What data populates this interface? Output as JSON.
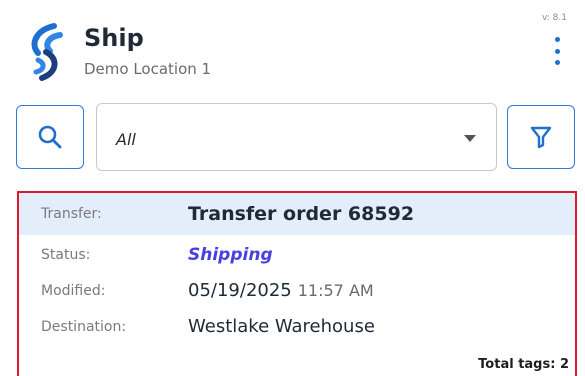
{
  "app": {
    "title": "Ship",
    "location": "Demo Location 1",
    "version": "v: 8.1",
    "brand_color": "#1f6fd1"
  },
  "filter": {
    "search_icon": "search-icon",
    "selected": "All",
    "filter_icon": "funnel-icon"
  },
  "card": {
    "transfer_label": "Transfer:",
    "transfer_value": "Transfer order 68592",
    "status_label": "Status:",
    "status_value": "Shipping",
    "status_color": "#4a3fe0",
    "modified_label": "Modified:",
    "modified_date": "05/19/2025",
    "modified_time": "11:57 AM",
    "destination_label": "Destination:",
    "destination_value": "Westlake Warehouse",
    "total_tags": "Total tags: 2",
    "highlight_border_color": "#e0192b"
  }
}
